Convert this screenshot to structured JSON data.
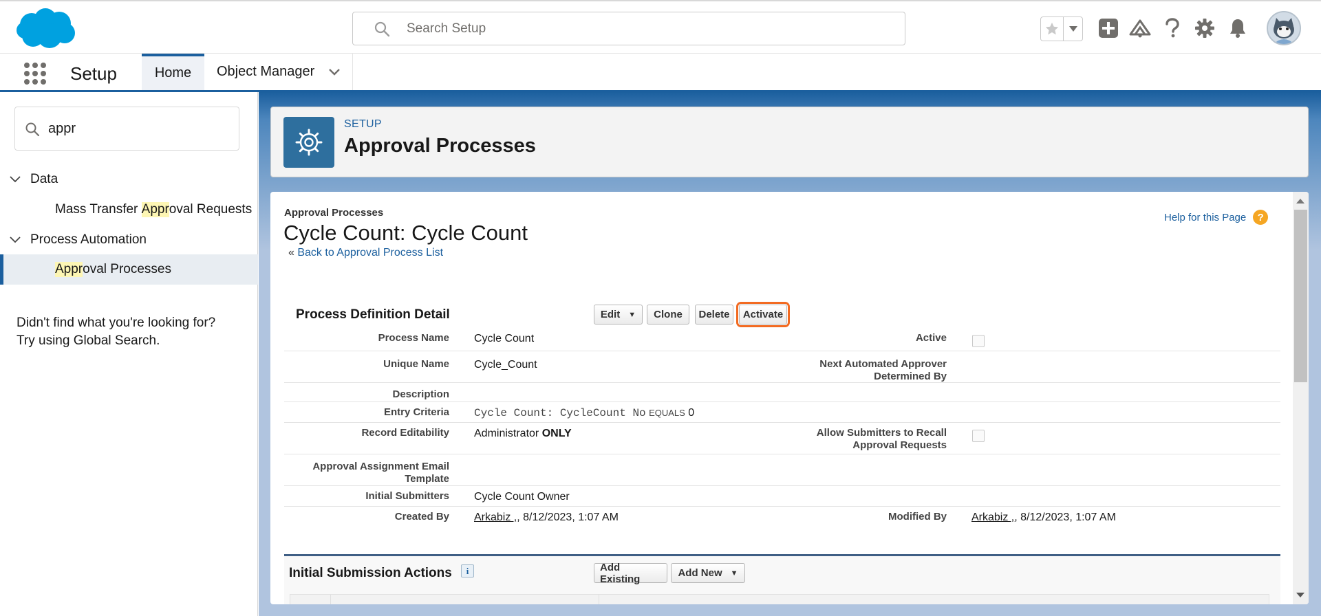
{
  "header": {
    "search_placeholder": "Search Setup",
    "icons": [
      "salesforce-cloud-logo",
      "search-icon",
      "star-icon",
      "chevron-down-icon",
      "add-icon",
      "trailhead-icon",
      "help-icon",
      "gear-icon",
      "bell-icon",
      "avatar"
    ]
  },
  "context_bar": {
    "app_name": "Setup",
    "tabs": [
      {
        "label": "Home",
        "active": true
      },
      {
        "label": "Object Manager",
        "active": false
      }
    ]
  },
  "sidebar": {
    "quickfind_value": "appr",
    "tree": [
      {
        "label": "Data",
        "expanded": true,
        "children": [
          {
            "pre": "Mass Transfer ",
            "highlight": "Appr",
            "post": "oval Requests",
            "selected": false
          }
        ]
      },
      {
        "label": "Process Automation",
        "expanded": true,
        "children": [
          {
            "pre": "",
            "highlight": "Appr",
            "post": "oval Processes",
            "selected": true
          }
        ]
      }
    ],
    "not_found_line1": "Didn't find what you're looking for?",
    "not_found_line2": "Try using Global Search."
  },
  "page_header": {
    "kicker": "SETUP",
    "title": "Approval Processes"
  },
  "detail": {
    "breadcrumb": "Approval Processes",
    "title": "Cycle Count: Cycle Count",
    "back_prefix": "«",
    "back_link": "Back to Approval Process List",
    "help_link": "Help for this Page",
    "section_title": "Process Definition Detail",
    "buttons": {
      "edit": "Edit",
      "clone": "Clone",
      "delete": "Delete",
      "activate": "Activate"
    },
    "fields": {
      "process_name_label": "Process Name",
      "process_name_value": "Cycle Count",
      "active_label": "Active",
      "active_checked": false,
      "unique_name_label": "Unique Name",
      "unique_name_value": "Cycle_Count",
      "next_approver_label_1": "Next Automated Approver",
      "next_approver_label_2": "Determined By",
      "description_label": "Description",
      "entry_criteria_label": "Entry Criteria",
      "entry_criteria_field": "Cycle Count: CycleCount No",
      "entry_criteria_op": "EQUALS",
      "entry_criteria_value": "0",
      "record_editability_label": "Record Editability",
      "record_editability_value": "Administrator",
      "record_editability_bold": "ONLY",
      "allow_recall_label_1": "Allow Submitters to Recall",
      "allow_recall_label_2": "Approval Requests",
      "allow_recall_checked": false,
      "email_template_label_1": "Approval Assignment Email",
      "email_template_label_2": "Template",
      "initial_submitters_label": "Initial Submitters",
      "initial_submitters_value": "Cycle Count Owner",
      "created_by_label": "Created By",
      "created_by_user": "Arkabiz ,",
      "created_by_date": ", 8/12/2023, 1:07 AM",
      "modified_by_label": "Modified By",
      "modified_by_user": "Arkabiz ,",
      "modified_by_date": ", 8/12/2023, 1:07 AM"
    },
    "initial_submission": {
      "title": "Initial Submission Actions",
      "info_glyph": "i",
      "add_existing": "Add Existing",
      "add_new": "Add New"
    }
  },
  "colors": {
    "brand_blue": "#1b5f9e",
    "highlight": "#fdf6b4",
    "activate_outline": "#f26a21",
    "help_orange": "#f5a623"
  }
}
